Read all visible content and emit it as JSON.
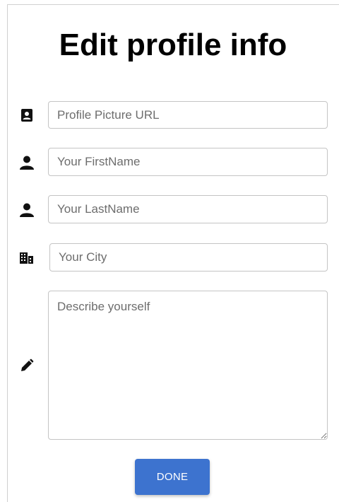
{
  "page": {
    "title": "Edit profile info"
  },
  "form": {
    "profile_picture": {
      "placeholder": "Profile Picture URL",
      "icon": "contact-card-icon"
    },
    "first_name": {
      "placeholder": "Your FirstName",
      "icon": "person-icon"
    },
    "last_name": {
      "placeholder": "Your LastName",
      "icon": "person-icon"
    },
    "city": {
      "placeholder": "Your City",
      "icon": "city-icon"
    },
    "description": {
      "placeholder": "Describe yourself",
      "icon": "pencil-icon"
    },
    "done_label": "DONE"
  },
  "colors": {
    "accent": "#3d73cf",
    "border": "#c4c4c4",
    "icon": "#111111"
  }
}
